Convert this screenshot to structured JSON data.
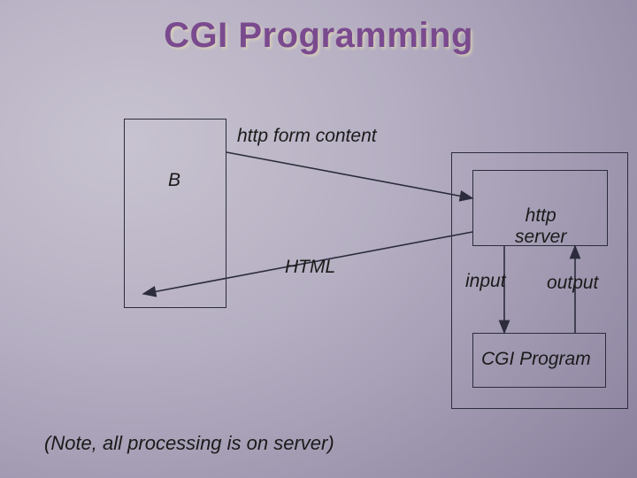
{
  "title": "CGI Programming",
  "labels": {
    "form": "http form content",
    "b": "B",
    "html": "HTML",
    "httpserver": "http\nserver",
    "input": "input",
    "output": "output",
    "cgi": "CGI Program"
  },
  "note": "(Note, all processing is on server)"
}
